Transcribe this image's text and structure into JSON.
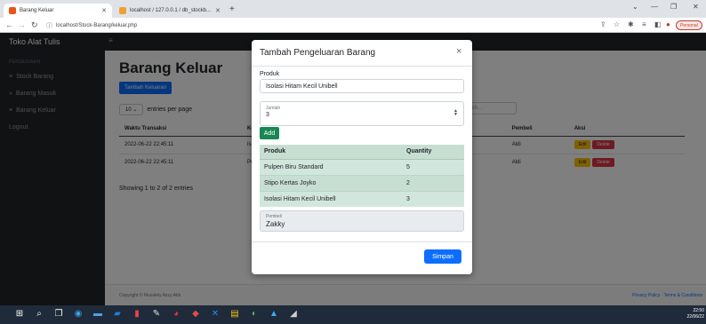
{
  "browser": {
    "tabs": [
      {
        "title": "Barang Keluar",
        "active": true,
        "favicon_color": "#e8541a"
      },
      {
        "title": "localhost / 127.0.0.1 / db_stockb...",
        "active": false,
        "favicon_color": "#f0a030"
      }
    ],
    "new_tab": "+",
    "url": "localhost/Stock-Barang/keluar.php",
    "profile_label": "Personal",
    "window_controls": [
      "⌄",
      "—",
      "❐",
      "✕"
    ]
  },
  "app": {
    "brand": "Toko Alat Tulis",
    "menu_toggle": "≡",
    "sidebar": {
      "heading": "PERSEDIAAN",
      "items": [
        {
          "label": "Stock Barang",
          "icon": "≡"
        },
        {
          "label": "Barang Masuk",
          "icon": "»"
        },
        {
          "label": "Barang Keluar",
          "icon": "≡"
        },
        {
          "label": "Logout",
          "icon": ""
        }
      ]
    },
    "page_title": "Barang Keluar",
    "add_button": "Tambah Keluaran",
    "entries_select": "10",
    "entries_suffix": "entries per page",
    "search_placeholder": "Search...",
    "table": {
      "headers": [
        "Waktu Transaksi",
        "Ke",
        "",
        "Pembeli",
        "Aksi"
      ],
      "rows": [
        {
          "waktu": "2022-06-22 22:45:11",
          "ke": "Isol",
          "pembeli": "Aldi"
        },
        {
          "waktu": "2022-06-22 22:45:11",
          "ke": "Pen",
          "pembeli": "Aldi"
        }
      ],
      "edit_label": "Edit",
      "delete_label": "Delete"
    },
    "showing": "Showing 1 to 2 of 2 entries",
    "copyright": "Copyright © Muzakky Azzy Akb",
    "footer_links": "Privacy Policy · Terms & Conditions"
  },
  "modal": {
    "title": "Tambah Pengeluaran Barang",
    "close": "×",
    "produk_label": "Produk",
    "produk_value": "Isolasi Hitam Kecil Unibell",
    "jumlah_label": "Jumlah",
    "jumlah_value": "3",
    "add_button": "Add",
    "items_headers": [
      "Produk",
      "Quantity"
    ],
    "items": [
      {
        "produk": "Pulpen Biru Standard",
        "qty": "5"
      },
      {
        "produk": "Stipo Kertas Joyko",
        "qty": "2"
      },
      {
        "produk": "Isolasi Hitam Kecil Unibell",
        "qty": "3"
      }
    ],
    "pembeli_label": "Pembeli",
    "pembeli_value": "Zakky",
    "save_button": "Simpan"
  },
  "taskbar": {
    "time": "22:50",
    "date": "22/06/22"
  }
}
